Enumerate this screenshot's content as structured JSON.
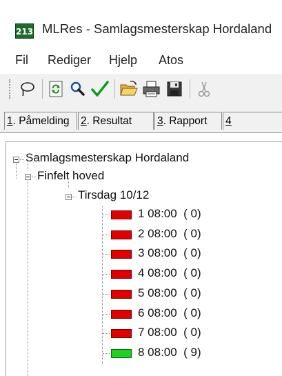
{
  "window": {
    "icon_text": "213",
    "title": "MLRes - Samlagsmesterskap Hordaland"
  },
  "menu": [
    "Fil",
    "Rediger",
    "Hjelp",
    "Atos"
  ],
  "toolbar": {
    "icons": [
      "lasso-icon",
      "refresh-icon",
      "search-icon",
      "checkmark-icon",
      "open-folder-icon",
      "print-icon",
      "save-icon",
      "cut-icon"
    ]
  },
  "tabs": [
    {
      "num": "1",
      "label": ". Påmelding"
    },
    {
      "num": "2",
      "label": ". Resultat"
    },
    {
      "num": "3",
      "label": ". Rapport"
    },
    {
      "num": "4",
      "label": ""
    }
  ],
  "tree": {
    "root": "Samlagsmesterskap Hordaland",
    "event": "Finfelt hoved",
    "day": "Tirsdag 10/12",
    "heats": [
      {
        "label": "1 08:00  ( 0)",
        "status": "red"
      },
      {
        "label": "2 08:00  ( 0)",
        "status": "red"
      },
      {
        "label": "3 08:00  ( 0)",
        "status": "red"
      },
      {
        "label": "4 08:00  ( 0)",
        "status": "red"
      },
      {
        "label": "5 08:00  ( 0)",
        "status": "red"
      },
      {
        "label": "6 08:00  ( 0)",
        "status": "red"
      },
      {
        "label": "7 08:00  ( 0)",
        "status": "red"
      },
      {
        "label": "8 08:00  ( 9)",
        "status": "green"
      }
    ]
  },
  "colors": {
    "red": "#e00000",
    "green": "#1ed21e",
    "toolbar_bg": "#f1f1f1"
  }
}
